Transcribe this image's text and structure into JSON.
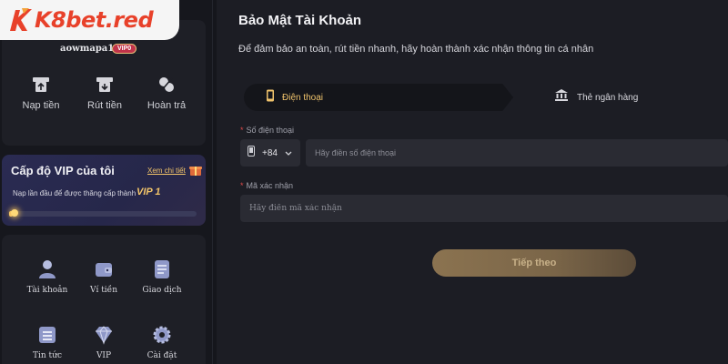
{
  "brand": {
    "logo_text": "K8bet.red",
    "colors": {
      "logo_red": "#e8412a",
      "accent_gold": "#f0c36c"
    }
  },
  "user": {
    "username": "aowmapa1",
    "badge": "VIP0"
  },
  "quick_actions": [
    {
      "label": "Nạp tiền",
      "icon": "deposit-icon"
    },
    {
      "label": "Rút tiền",
      "icon": "withdraw-icon"
    },
    {
      "label": "Hoàn trả",
      "icon": "rebate-icon"
    }
  ],
  "vip": {
    "title": "Cấp độ VIP của tôi",
    "detail_link": "Xem chi tiết",
    "description": "Nạp lần đầu để được thăng cấp thành",
    "next_level": "VIP 1",
    "progress": 0.02
  },
  "menu": [
    {
      "label": "Tài khoản",
      "icon": "account-icon"
    },
    {
      "label": "Ví tiền",
      "icon": "wallet-icon"
    },
    {
      "label": "Giao dịch",
      "icon": "transactions-icon"
    },
    {
      "label": "Tin tức",
      "icon": "news-icon"
    },
    {
      "label": "VIP",
      "icon": "vip-diamond-icon"
    },
    {
      "label": "Cài đặt",
      "icon": "settings-icon"
    }
  ],
  "main": {
    "title": "Bảo Mật Tài Khoản",
    "subtitle": "Để đảm bảo an toàn, rút tiền nhanh, hãy hoàn thành xác nhận thông tin cá nhân",
    "tabs": [
      {
        "label": "Điện thoại",
        "active": true
      },
      {
        "label": "Thẻ ngân hàng",
        "active": false
      }
    ],
    "phone": {
      "label": "Số điện thoại",
      "country_code": "+84",
      "placeholder": "Hãy điền số điện thoại",
      "value": ""
    },
    "code": {
      "label": "Mã xác nhận",
      "placeholder": "Hãy điền mã xác nhận",
      "value": ""
    },
    "next_button": "Tiếp theo"
  }
}
